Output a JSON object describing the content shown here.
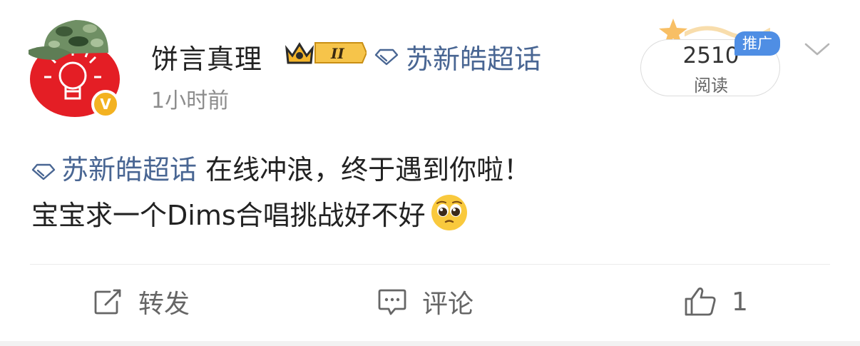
{
  "post": {
    "username": "饼言真理",
    "level_badge": "II",
    "topic": "苏新皓超话",
    "time": "1小时前",
    "reads": {
      "count": "2510",
      "label": "阅读",
      "promo_tag": "推广"
    },
    "body": {
      "topic": "苏新皓超话",
      "line1_text": " 在线冲浪，终于遇到你啦！",
      "line2_text": "宝宝求一个Dims合唱挑战好不好"
    },
    "emoji": "pleading-face",
    "actions": {
      "repost_label": "转发",
      "comment_label": "评论",
      "like_count": "1"
    }
  },
  "colors": {
    "topic_link": "#496693",
    "promo_tag": "#4f8ee4",
    "avatar_bg": "#e41e25",
    "verified_badge": "#f3b221"
  },
  "icons": {
    "verified": "verified-v-icon",
    "topic": "diamond-icon",
    "more": "chevron-down-icon",
    "repost": "repost-icon",
    "comment": "comment-icon",
    "like": "thumbs-up-icon"
  }
}
